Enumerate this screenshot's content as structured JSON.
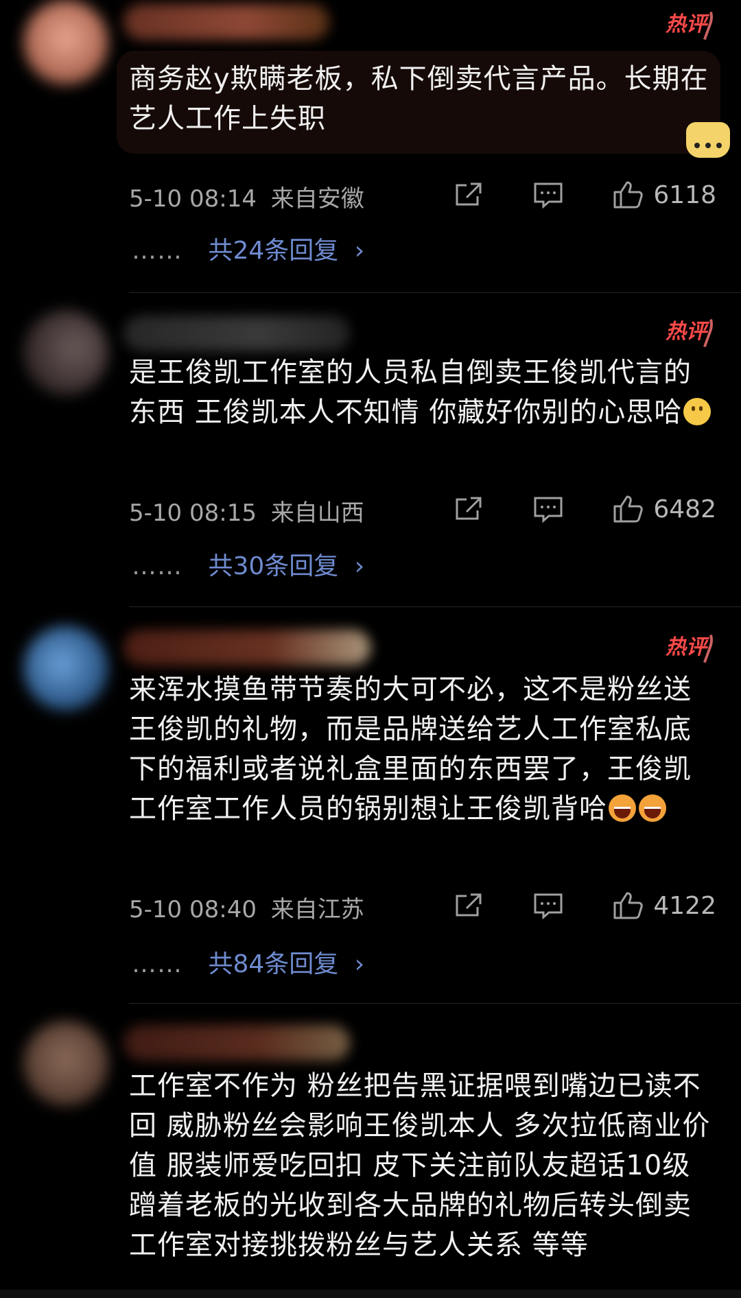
{
  "comments": [
    {
      "hot_label": "热评",
      "text": "商务赵y欺瞒老板，私下倒卖代言产品。长期在艺人工作上失职",
      "time": "5-10 08:14",
      "location": "来自安徽",
      "likes": "6118",
      "replies_dots": "……",
      "replies_label": "共24条回复",
      "replies_arrow": "›"
    },
    {
      "hot_label": "热评",
      "text": "是王俊凯工作室的人员私自倒卖王俊凯代言的东西  王俊凯本人不知情  你藏好你别的心思哈",
      "time": "5-10 08:15",
      "location": "来自山西",
      "likes": "6482",
      "replies_dots": "……",
      "replies_label": "共30条回复",
      "replies_arrow": "›"
    },
    {
      "hot_label": "热评",
      "text": "来浑水摸鱼带节奏的大可不必，这不是粉丝送王俊凯的礼物，而是品牌送给艺人工作室私底下的福利或者说礼盒里面的东西罢了，王俊凯工作室工作人员的锅别想让王俊凯背哈",
      "time": "5-10 08:40",
      "location": "来自江苏",
      "likes": "4122",
      "replies_dots": "……",
      "replies_label": "共84条回复",
      "replies_arrow": "›"
    },
    {
      "text": "工作室不作为  粉丝把告黑证据喂到嘴边已读不回  威胁粉丝会影响王俊凯本人  多次拉低商业价值  服装师爱吃回扣  皮下关注前队友超话10级  蹭着老板的光收到各大品牌的礼物后转头倒卖  工作室对接挑拨粉丝与艺人关系  等等"
    }
  ],
  "colors": {
    "background": "#000000",
    "hot": "#ff4a4a",
    "reply_link": "#6f8bd0",
    "meta": "#a8a8a8"
  },
  "icons": [
    "share-icon",
    "comment-icon",
    "like-icon",
    "emoji-smile-icon",
    "emoji-laugh-icon"
  ]
}
